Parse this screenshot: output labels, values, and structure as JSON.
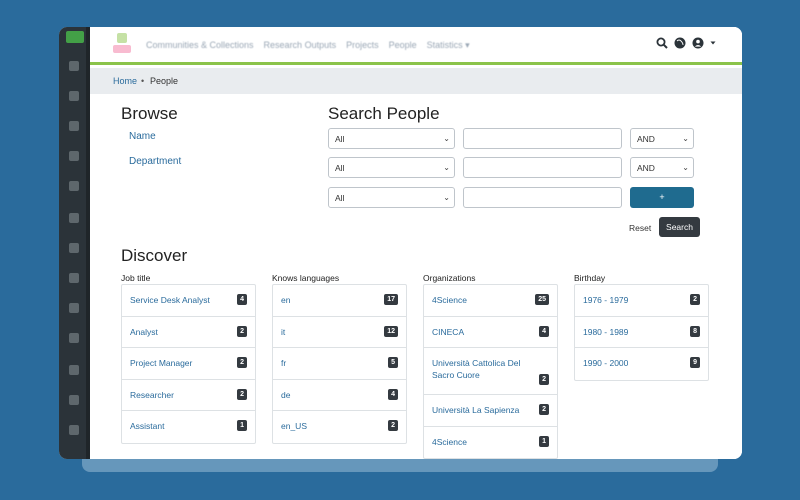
{
  "nav": {
    "links": [
      "Communities & Collections",
      "Research Outputs",
      "Projects",
      "People",
      "Statistics ▾"
    ]
  },
  "breadcrumb": {
    "home": "Home",
    "separator": "•",
    "current": "People"
  },
  "browse": {
    "title": "Browse",
    "links": [
      "Name",
      "Department"
    ]
  },
  "search": {
    "title": "Search People",
    "rows": [
      {
        "field": "All",
        "value": "",
        "operator": "AND"
      },
      {
        "field": "All",
        "value": "",
        "operator": "AND"
      },
      {
        "field": "All",
        "value": ""
      }
    ],
    "add_label": "+",
    "reset_label": "Reset",
    "search_label": "Search"
  },
  "discover": {
    "title": "Discover",
    "facets": [
      {
        "title": "Job title",
        "items": [
          {
            "label": "Service Desk Analyst",
            "count": "4"
          },
          {
            "label": "Analyst",
            "count": "2"
          },
          {
            "label": "Project Manager",
            "count": "2"
          },
          {
            "label": "Researcher",
            "count": "2"
          },
          {
            "label": "Assistant",
            "count": "1"
          }
        ]
      },
      {
        "title": "Knows languages",
        "items": [
          {
            "label": "en",
            "count": "17"
          },
          {
            "label": "it",
            "count": "12"
          },
          {
            "label": "fr",
            "count": "5"
          },
          {
            "label": "de",
            "count": "4"
          },
          {
            "label": "en_US",
            "count": "2"
          }
        ]
      },
      {
        "title": "Organizations",
        "items": [
          {
            "label": "4Science",
            "count": "25"
          },
          {
            "label": "CINECA",
            "count": "4"
          },
          {
            "label": "Università Cattolica Del Sacro Cuore",
            "count": "2"
          },
          {
            "label": "Università La Sapienza",
            "count": "2"
          },
          {
            "label": "4Science",
            "count": "1"
          }
        ]
      },
      {
        "title": "Birthday",
        "items": [
          {
            "label": "1976 - 1979",
            "count": "2"
          },
          {
            "label": "1980 - 1989",
            "count": "8"
          },
          {
            "label": "1990 - 2000",
            "count": "9"
          }
        ]
      }
    ]
  },
  "colors": {
    "accent": "#2a6b9c",
    "navbar_border": "#8bc34a",
    "badge": "#343a40",
    "primary_button": "#1f6b8f"
  },
  "icons": [
    "search-icon",
    "globe-icon",
    "user-icon",
    "chevron-down-icon"
  ]
}
